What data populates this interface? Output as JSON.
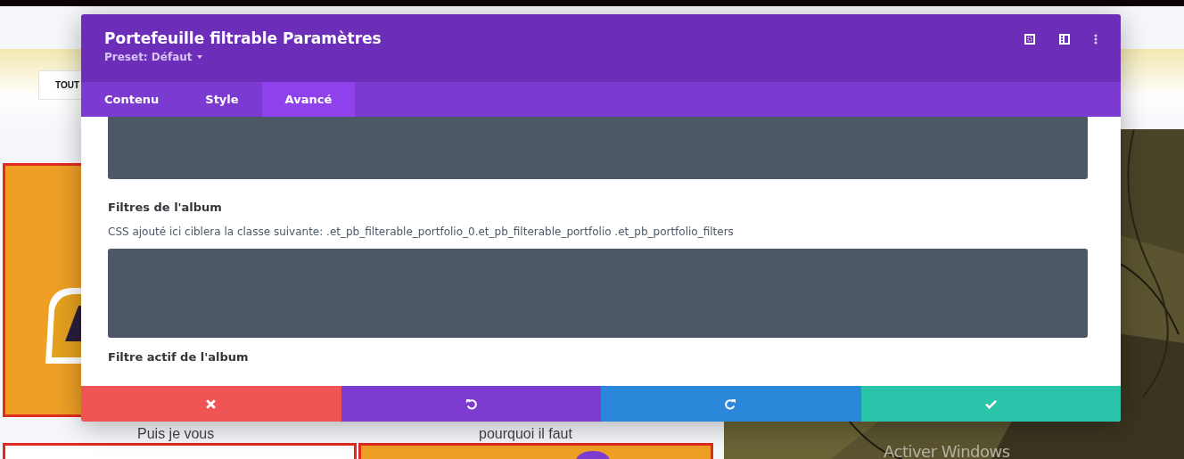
{
  "page": {
    "filter_button": "TOUT",
    "captions": [
      "Puis je vous",
      "pourquoi il faut"
    ],
    "os_notice": "Activer Windows"
  },
  "modal": {
    "title": "Portefeuille filtrable Paramètres",
    "preset": "Preset: Défaut",
    "tabs": [
      {
        "label": "Contenu",
        "selected": false
      },
      {
        "label": "Style",
        "selected": false
      },
      {
        "label": "Avancé",
        "selected": true
      }
    ],
    "fields": [
      {
        "kind": "editor"
      },
      {
        "kind": "labelled",
        "label": "Filtres de l'album",
        "description": "CSS ajouté ici ciblera la classe suivante: .et_pb_filterable_portfolio_0.et_pb_filterable_portfolio .et_pb_portfolio_filters"
      },
      {
        "kind": "heading",
        "label": "Filtre actif de l'album"
      }
    ],
    "actions": [
      {
        "kind": "cancel"
      },
      {
        "kind": "undo"
      },
      {
        "kind": "redo"
      },
      {
        "kind": "save"
      }
    ]
  }
}
